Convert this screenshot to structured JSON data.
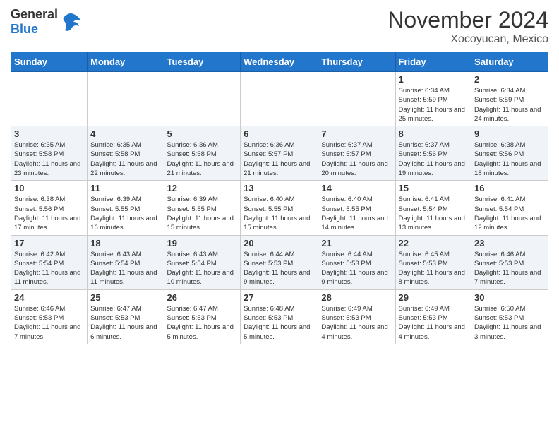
{
  "logo": {
    "general": "General",
    "blue": "Blue"
  },
  "header": {
    "month": "November 2024",
    "location": "Xocoyucan, Mexico"
  },
  "weekdays": [
    "Sunday",
    "Monday",
    "Tuesday",
    "Wednesday",
    "Thursday",
    "Friday",
    "Saturday"
  ],
  "weeks": [
    [
      {
        "day": "",
        "info": ""
      },
      {
        "day": "",
        "info": ""
      },
      {
        "day": "",
        "info": ""
      },
      {
        "day": "",
        "info": ""
      },
      {
        "day": "",
        "info": ""
      },
      {
        "day": "1",
        "info": "Sunrise: 6:34 AM\nSunset: 5:59 PM\nDaylight: 11 hours and 25 minutes."
      },
      {
        "day": "2",
        "info": "Sunrise: 6:34 AM\nSunset: 5:59 PM\nDaylight: 11 hours and 24 minutes."
      }
    ],
    [
      {
        "day": "3",
        "info": "Sunrise: 6:35 AM\nSunset: 5:58 PM\nDaylight: 11 hours and 23 minutes."
      },
      {
        "day": "4",
        "info": "Sunrise: 6:35 AM\nSunset: 5:58 PM\nDaylight: 11 hours and 22 minutes."
      },
      {
        "day": "5",
        "info": "Sunrise: 6:36 AM\nSunset: 5:58 PM\nDaylight: 11 hours and 21 minutes."
      },
      {
        "day": "6",
        "info": "Sunrise: 6:36 AM\nSunset: 5:57 PM\nDaylight: 11 hours and 21 minutes."
      },
      {
        "day": "7",
        "info": "Sunrise: 6:37 AM\nSunset: 5:57 PM\nDaylight: 11 hours and 20 minutes."
      },
      {
        "day": "8",
        "info": "Sunrise: 6:37 AM\nSunset: 5:56 PM\nDaylight: 11 hours and 19 minutes."
      },
      {
        "day": "9",
        "info": "Sunrise: 6:38 AM\nSunset: 5:56 PM\nDaylight: 11 hours and 18 minutes."
      }
    ],
    [
      {
        "day": "10",
        "info": "Sunrise: 6:38 AM\nSunset: 5:56 PM\nDaylight: 11 hours and 17 minutes."
      },
      {
        "day": "11",
        "info": "Sunrise: 6:39 AM\nSunset: 5:55 PM\nDaylight: 11 hours and 16 minutes."
      },
      {
        "day": "12",
        "info": "Sunrise: 6:39 AM\nSunset: 5:55 PM\nDaylight: 11 hours and 15 minutes."
      },
      {
        "day": "13",
        "info": "Sunrise: 6:40 AM\nSunset: 5:55 PM\nDaylight: 11 hours and 15 minutes."
      },
      {
        "day": "14",
        "info": "Sunrise: 6:40 AM\nSunset: 5:55 PM\nDaylight: 11 hours and 14 minutes."
      },
      {
        "day": "15",
        "info": "Sunrise: 6:41 AM\nSunset: 5:54 PM\nDaylight: 11 hours and 13 minutes."
      },
      {
        "day": "16",
        "info": "Sunrise: 6:41 AM\nSunset: 5:54 PM\nDaylight: 11 hours and 12 minutes."
      }
    ],
    [
      {
        "day": "17",
        "info": "Sunrise: 6:42 AM\nSunset: 5:54 PM\nDaylight: 11 hours and 11 minutes."
      },
      {
        "day": "18",
        "info": "Sunrise: 6:43 AM\nSunset: 5:54 PM\nDaylight: 11 hours and 11 minutes."
      },
      {
        "day": "19",
        "info": "Sunrise: 6:43 AM\nSunset: 5:54 PM\nDaylight: 11 hours and 10 minutes."
      },
      {
        "day": "20",
        "info": "Sunrise: 6:44 AM\nSunset: 5:53 PM\nDaylight: 11 hours and 9 minutes."
      },
      {
        "day": "21",
        "info": "Sunrise: 6:44 AM\nSunset: 5:53 PM\nDaylight: 11 hours and 9 minutes."
      },
      {
        "day": "22",
        "info": "Sunrise: 6:45 AM\nSunset: 5:53 PM\nDaylight: 11 hours and 8 minutes."
      },
      {
        "day": "23",
        "info": "Sunrise: 6:46 AM\nSunset: 5:53 PM\nDaylight: 11 hours and 7 minutes."
      }
    ],
    [
      {
        "day": "24",
        "info": "Sunrise: 6:46 AM\nSunset: 5:53 PM\nDaylight: 11 hours and 7 minutes."
      },
      {
        "day": "25",
        "info": "Sunrise: 6:47 AM\nSunset: 5:53 PM\nDaylight: 11 hours and 6 minutes."
      },
      {
        "day": "26",
        "info": "Sunrise: 6:47 AM\nSunset: 5:53 PM\nDaylight: 11 hours and 5 minutes."
      },
      {
        "day": "27",
        "info": "Sunrise: 6:48 AM\nSunset: 5:53 PM\nDaylight: 11 hours and 5 minutes."
      },
      {
        "day": "28",
        "info": "Sunrise: 6:49 AM\nSunset: 5:53 PM\nDaylight: 11 hours and 4 minutes."
      },
      {
        "day": "29",
        "info": "Sunrise: 6:49 AM\nSunset: 5:53 PM\nDaylight: 11 hours and 4 minutes."
      },
      {
        "day": "30",
        "info": "Sunrise: 6:50 AM\nSunset: 5:53 PM\nDaylight: 11 hours and 3 minutes."
      }
    ]
  ]
}
